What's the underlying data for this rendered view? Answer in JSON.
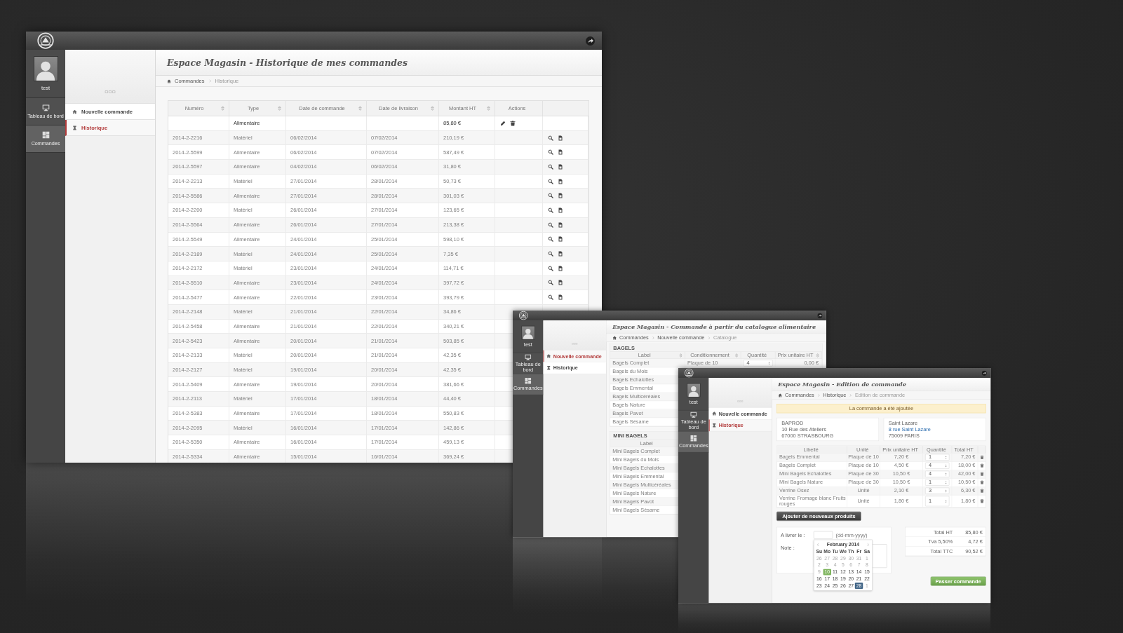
{
  "windows": [
    {
      "kind": "history",
      "user": "test",
      "nav": [
        {
          "label": "Tableau de bord",
          "selected": false
        },
        {
          "label": "Commandes",
          "selected": true
        }
      ],
      "subnav": [
        {
          "label": "Nouvelle commande",
          "selected": false
        },
        {
          "label": "Historique",
          "selected": true
        }
      ],
      "title": "Espace Magasin - Historique de mes commandes",
      "breadcrumb": [
        "Commandes",
        "Historique"
      ],
      "table": {
        "columns": [
          {
            "label": "Numéro",
            "sortable": true
          },
          {
            "label": "Type",
            "sortable": true
          },
          {
            "label": "Date de commande",
            "sortable": true
          },
          {
            "label": "Date de livraison",
            "sortable": true
          },
          {
            "label": "Montant HT",
            "sortable": true
          },
          {
            "label": "Actions",
            "sortable": false
          }
        ],
        "rows": [
          {
            "type": "Alimentaire",
            "montant": "85,80 €",
            "editable": true
          },
          {
            "numero": "2014-2-2216",
            "type": "Matériel",
            "date_commande": "06/02/2014",
            "date_livraison": "07/02/2014",
            "montant": "210,19 €",
            "editable": false
          },
          {
            "numero": "2014-2-5599",
            "type": "Alimentaire",
            "date_commande": "06/02/2014",
            "date_livraison": "07/02/2014",
            "montant": "587,49 €",
            "editable": false
          },
          {
            "numero": "2014-2-5597",
            "type": "Alimentaire",
            "date_commande": "04/02/2014",
            "date_livraison": "06/02/2014",
            "montant": "31,80 €",
            "editable": false
          },
          {
            "numero": "2014-2-2213",
            "type": "Matériel",
            "date_commande": "27/01/2014",
            "date_livraison": "28/01/2014",
            "montant": "50,73 €",
            "editable": false
          },
          {
            "numero": "2014-2-5586",
            "type": "Alimentaire",
            "date_commande": "27/01/2014",
            "date_livraison": "28/01/2014",
            "montant": "301,03 €",
            "editable": false
          },
          {
            "numero": "2014-2-2200",
            "type": "Matériel",
            "date_commande": "26/01/2014",
            "date_livraison": "27/01/2014",
            "montant": "123,65 €",
            "editable": false
          },
          {
            "numero": "2014-2-5564",
            "type": "Alimentaire",
            "date_commande": "26/01/2014",
            "date_livraison": "27/01/2014",
            "montant": "213,38 €",
            "editable": false
          },
          {
            "numero": "2014-2-5549",
            "type": "Alimentaire",
            "date_commande": "24/01/2014",
            "date_livraison": "25/01/2014",
            "montant": "598,10 €",
            "editable": false
          },
          {
            "numero": "2014-2-2189",
            "type": "Matériel",
            "date_commande": "24/01/2014",
            "date_livraison": "25/01/2014",
            "montant": "7,35 €",
            "editable": false
          },
          {
            "numero": "2014-2-2172",
            "type": "Matériel",
            "date_commande": "23/01/2014",
            "date_livraison": "24/01/2014",
            "montant": "114,71 €",
            "editable": false
          },
          {
            "numero": "2014-2-5510",
            "type": "Alimentaire",
            "date_commande": "23/01/2014",
            "date_livraison": "24/01/2014",
            "montant": "397,72 €",
            "editable": false
          },
          {
            "numero": "2014-2-5477",
            "type": "Alimentaire",
            "date_commande": "22/01/2014",
            "date_livraison": "23/01/2014",
            "montant": "393,79 €",
            "editable": false
          },
          {
            "numero": "2014-2-2148",
            "type": "Matériel",
            "date_commande": "21/01/2014",
            "date_livraison": "22/01/2014",
            "montant": "34,86 €",
            "editable": false
          },
          {
            "numero": "2014-2-5458",
            "type": "Alimentaire",
            "date_commande": "21/01/2014",
            "date_livraison": "22/01/2014",
            "montant": "340,21 €",
            "editable": false
          },
          {
            "numero": "2014-2-5423",
            "type": "Alimentaire",
            "date_commande": "20/01/2014",
            "date_livraison": "21/01/2014",
            "montant": "503,85 €",
            "editable": false
          },
          {
            "numero": "2014-2-2133",
            "type": "Matériel",
            "date_commande": "20/01/2014",
            "date_livraison": "21/01/2014",
            "montant": "42,35 €",
            "editable": false
          },
          {
            "numero": "2014-2-2127",
            "type": "Matériel",
            "date_commande": "19/01/2014",
            "date_livraison": "20/01/2014",
            "montant": "42,35 €",
            "editable": false
          },
          {
            "numero": "2014-2-5409",
            "type": "Alimentaire",
            "date_commande": "19/01/2014",
            "date_livraison": "20/01/2014",
            "montant": "381,66 €",
            "editable": false
          },
          {
            "numero": "2014-2-2113",
            "type": "Matériel",
            "date_commande": "17/01/2014",
            "date_livraison": "18/01/2014",
            "montant": "44,40 €",
            "editable": false
          },
          {
            "numero": "2014-2-5383",
            "type": "Alimentaire",
            "date_commande": "17/01/2014",
            "date_livraison": "18/01/2014",
            "montant": "550,83 €",
            "editable": false
          },
          {
            "numero": "2014-2-2095",
            "type": "Matériel",
            "date_commande": "16/01/2014",
            "date_livraison": "17/01/2014",
            "montant": "142,86 €",
            "editable": false
          },
          {
            "numero": "2014-2-5350",
            "type": "Alimentaire",
            "date_commande": "16/01/2014",
            "date_livraison": "17/01/2014",
            "montant": "459,13 €",
            "editable": false
          },
          {
            "numero": "2014-2-5334",
            "type": "Alimentaire",
            "date_commande": "15/01/2014",
            "date_livraison": "16/01/2014",
            "montant": "369,24 €",
            "editable": false
          }
        ]
      }
    },
    {
      "kind": "catalog",
      "user": "test",
      "nav": [
        {
          "label": "Tableau de bord",
          "selected": false
        },
        {
          "label": "Commandes",
          "selected": true
        }
      ],
      "subnav": [
        {
          "label": "Nouvelle commande",
          "selected": true
        },
        {
          "label": "Historique",
          "selected": false
        }
      ],
      "title": "Espace Magasin - Commande à partir du catalogue alimentaire",
      "breadcrumb": [
        "Commandes",
        "Nouvelle commande",
        "Catalogue"
      ],
      "sections": [
        {
          "title": "BAGELS",
          "columns": [
            {
              "label": "Label",
              "sortable": true
            },
            {
              "label": "Conditionnement",
              "sortable": true
            },
            {
              "label": "Quantité",
              "sortable": false
            },
            {
              "label": "Prix unitaire HT",
              "sortable": true
            }
          ],
          "rows": [
            {
              "label": "Bagels Complet",
              "packaging": "Plaque de 10",
              "quantity": "4",
              "price": "0,00 €"
            },
            {
              "label": "Bagels du Mois"
            },
            {
              "label": "Bagels Echalottes"
            },
            {
              "label": "Bagels Emmental"
            },
            {
              "label": "Bagels Multicéréales"
            },
            {
              "label": "Bagels Nature"
            },
            {
              "label": "Bagels Pavot"
            },
            {
              "label": "Bagels Sésame"
            }
          ]
        },
        {
          "title": "MINI BAGELS",
          "columns": [
            {
              "label": "Label",
              "sortable": false
            }
          ],
          "rows": [
            {
              "label": "Mini Bagels Complet"
            },
            {
              "label": "Mini Bagels du Mois"
            },
            {
              "label": "Mini Bagels Echalottes"
            },
            {
              "label": "Mini Bagels Emmental"
            },
            {
              "label": "Mini Bagels Multicéréales"
            },
            {
              "label": "Mini Bagels Nature"
            },
            {
              "label": "Mini Bagels Pavot"
            },
            {
              "label": "Mini Bagels Sésame"
            }
          ]
        }
      ]
    },
    {
      "kind": "order_edit",
      "user": "test",
      "nav": [
        {
          "label": "Tableau de bord",
          "selected": false
        },
        {
          "label": "Commandes",
          "selected": true
        }
      ],
      "subnav": [
        {
          "label": "Nouvelle commande",
          "selected": false
        },
        {
          "label": "Historique",
          "selected": true
        }
      ],
      "title": "Espace Magasin - Edition de commande",
      "breadcrumb": [
        "Commandes",
        "Historique",
        "Edition de commande"
      ],
      "alert": "La commande a été ajoutée",
      "addresses": [
        [
          {
            "text": "BAPROD",
            "link": false
          },
          {
            "text": "10 Rue des Ateliers",
            "link": false
          },
          {
            "text": "67000 STRASBOURG",
            "link": false
          }
        ],
        [
          {
            "text": "Saint Lazare",
            "link": false
          },
          {
            "text": "8 rue Saint Lazare",
            "link": true
          },
          {
            "text": "75009 PARIS",
            "link": false
          }
        ]
      ],
      "table": {
        "columns": [
          "Libellé",
          "Unité",
          "Prix unitaire HT",
          "Quantité",
          "Total HT"
        ],
        "rows": [
          {
            "label": "Bagels Emmental",
            "unit": "Plaque de 10",
            "price": "7,20 €",
            "quantity": "1",
            "total": "7,20 €"
          },
          {
            "label": "Bagels Complet",
            "unit": "Plaque de 10",
            "price": "4,50 €",
            "quantity": "4",
            "total": "18,00 €"
          },
          {
            "label": "Mini Bagels Echalottes",
            "unit": "Plaque de 30",
            "price": "10,50 €",
            "quantity": "4",
            "total": "42,00 €"
          },
          {
            "label": "Mini Bagels Nature",
            "unit": "Plaque de 30",
            "price": "10,50 €",
            "quantity": "1",
            "total": "10,50 €"
          },
          {
            "label": "Verrine Osez",
            "unit": "Unité",
            "price": "2,10 €",
            "quantity": "3",
            "total": "6,30 €"
          },
          {
            "label": "Verrine Fromage blanc Fruits rouges",
            "unit": "Unité",
            "price": "1,80 €",
            "quantity": "1",
            "total": "1,80 €"
          }
        ]
      },
      "add_button": "Ajouter de nouveaux produits",
      "delivery": {
        "label": "A livrer le :",
        "hint": "(dd-mm-yyyy)",
        "note_label": "Note :"
      },
      "datepicker": {
        "month": "February 2014",
        "weekdays": [
          "Su",
          "Mo",
          "Tu",
          "We",
          "Th",
          "Fr",
          "Sa"
        ],
        "days": [
          {
            "day": "26",
            "other_month": true,
            "today": false,
            "selected": false
          },
          {
            "day": "27",
            "other_month": true,
            "today": false,
            "selected": false
          },
          {
            "day": "28",
            "other_month": true,
            "today": false,
            "selected": false
          },
          {
            "day": "29",
            "other_month": true,
            "today": false,
            "selected": false
          },
          {
            "day": "30",
            "other_month": true,
            "today": false,
            "selected": false
          },
          {
            "day": "31",
            "other_month": true,
            "today": false,
            "selected": false
          },
          {
            "day": "1",
            "other_month": true,
            "today": false,
            "selected": false
          },
          {
            "day": "2",
            "other_month": true,
            "today": false,
            "selected": false
          },
          {
            "day": "3",
            "other_month": true,
            "today": false,
            "selected": false
          },
          {
            "day": "4",
            "other_month": true,
            "today": false,
            "selected": false
          },
          {
            "day": "5",
            "other_month": true,
            "today": false,
            "selected": false
          },
          {
            "day": "6",
            "other_month": true,
            "today": false,
            "selected": false
          },
          {
            "day": "7",
            "other_month": true,
            "today": false,
            "selected": false
          },
          {
            "day": "8",
            "other_month": true,
            "today": false,
            "selected": false
          },
          {
            "day": "9",
            "other_month": true,
            "today": false,
            "selected": false
          },
          {
            "day": "10",
            "other_month": false,
            "today": true,
            "selected": false
          },
          {
            "day": "11",
            "other_month": false,
            "today": false,
            "selected": false
          },
          {
            "day": "12",
            "other_month": false,
            "today": false,
            "selected": false
          },
          {
            "day": "13",
            "other_month": false,
            "today": false,
            "selected": false
          },
          {
            "day": "14",
            "other_month": false,
            "today": false,
            "selected": false
          },
          {
            "day": "15",
            "other_month": false,
            "today": false,
            "selected": false
          },
          {
            "day": "16",
            "other_month": false,
            "today": false,
            "selected": false
          },
          {
            "day": "17",
            "other_month": false,
            "today": false,
            "selected": false
          },
          {
            "day": "18",
            "other_month": false,
            "today": false,
            "selected": false
          },
          {
            "day": "19",
            "other_month": false,
            "today": false,
            "selected": false
          },
          {
            "day": "20",
            "other_month": false,
            "today": false,
            "selected": false
          },
          {
            "day": "21",
            "other_month": false,
            "today": false,
            "selected": false
          },
          {
            "day": "22",
            "other_month": false,
            "today": false,
            "selected": false
          },
          {
            "day": "23",
            "other_month": false,
            "today": false,
            "selected": false
          },
          {
            "day": "24",
            "other_month": false,
            "today": false,
            "selected": false
          },
          {
            "day": "25",
            "other_month": false,
            "today": false,
            "selected": false
          },
          {
            "day": "26",
            "other_month": false,
            "today": false,
            "selected": false
          },
          {
            "day": "27",
            "other_month": false,
            "today": false,
            "selected": false
          },
          {
            "day": "28",
            "other_month": false,
            "today": false,
            "selected": true
          },
          {
            "day": "1",
            "other_month": true,
            "today": false,
            "selected": false
          }
        ]
      },
      "totals": [
        {
          "label": "Total HT",
          "value": "85,80 €"
        },
        {
          "label": "Tva 5,50%",
          "value": "4,72 €"
        },
        {
          "label": "Total TTC",
          "value": "90,52 €"
        }
      ],
      "submit": "Passer commande"
    }
  ]
}
